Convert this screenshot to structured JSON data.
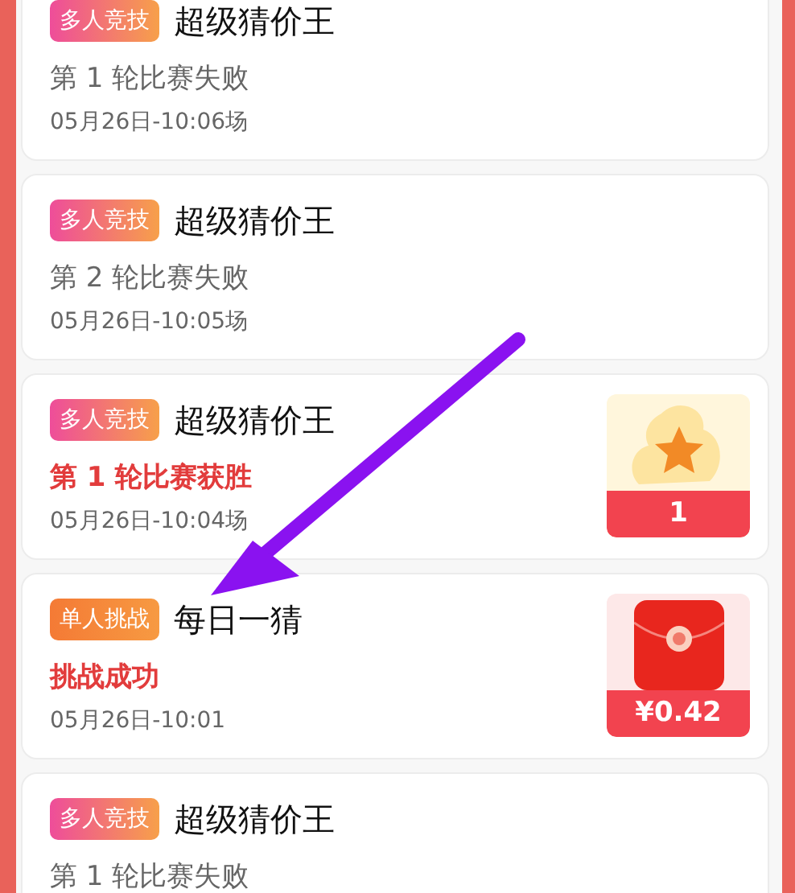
{
  "records": [
    {
      "badge": {
        "text": "多人竞技",
        "kind": "multi"
      },
      "title": "超级猜价王",
      "result": {
        "text": "第 1 轮比赛失败",
        "won": false
      },
      "time": "05月26日-10:06场"
    },
    {
      "badge": {
        "text": "多人竞技",
        "kind": "multi"
      },
      "title": "超级猜价王",
      "result": {
        "text": "第 2 轮比赛失败",
        "won": false
      },
      "time": "05月26日-10:05场"
    },
    {
      "badge": {
        "text": "多人竞技",
        "kind": "multi"
      },
      "title": "超级猜价王",
      "result": {
        "text": "第 1 轮比赛获胜",
        "won": true
      },
      "time": "05月26日-10:04场",
      "prize": {
        "kind": "star",
        "label": "1"
      }
    },
    {
      "badge": {
        "text": "单人挑战",
        "kind": "single"
      },
      "title": "每日一猜",
      "result": {
        "text": "挑战成功",
        "won": true
      },
      "time": "05月26日-10:01",
      "prize": {
        "kind": "red_packet",
        "label": "¥0.42"
      }
    },
    {
      "badge": {
        "text": "多人竞技",
        "kind": "multi"
      },
      "title": "超级猜价王",
      "result": {
        "text": "第 1 轮比赛失败",
        "won": false
      }
    }
  ]
}
